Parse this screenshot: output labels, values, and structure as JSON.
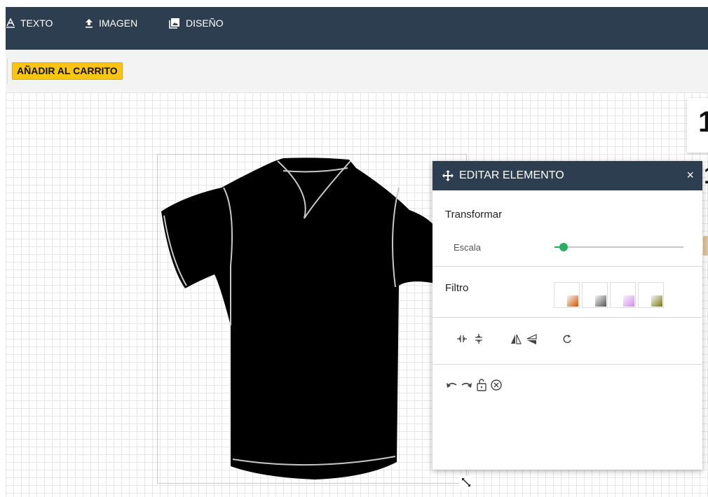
{
  "toolbar": {
    "tabs": [
      {
        "label": "TEXTO",
        "icon": "text-icon"
      },
      {
        "label": "IMAGEN",
        "icon": "upload-icon"
      },
      {
        "label": "DISEÑO",
        "icon": "image-icon"
      }
    ]
  },
  "actions": {
    "add_to_cart": "AÑADIR AL CARRITO"
  },
  "canvas": {
    "right_edge_digits": [
      "1",
      "1"
    ]
  },
  "panel": {
    "title": "EDITAR ELEMENTO",
    "close_glyph": "×",
    "transform": {
      "title": "Transformar",
      "scale_label": "Escala",
      "scale_value": 0.07
    },
    "filter": {
      "title": "Filtro",
      "options": [
        {
          "name": "sepia",
          "color": "#d35400"
        },
        {
          "name": "grayscale",
          "color": "#555555"
        },
        {
          "name": "purple",
          "color": "#d98bf2"
        },
        {
          "name": "olive",
          "color": "#7a7a12"
        }
      ]
    },
    "tools": [
      "center-horizontal-icon",
      "center-vertical-icon",
      "flip-horizontal-icon",
      "flip-vertical-icon",
      "reset-icon"
    ],
    "history": [
      "undo-icon",
      "redo-icon",
      "unlock-icon",
      "remove-icon"
    ]
  },
  "colors": {
    "header": "#2c3e50",
    "accent": "#f8c513",
    "slider": "#27ae60"
  }
}
